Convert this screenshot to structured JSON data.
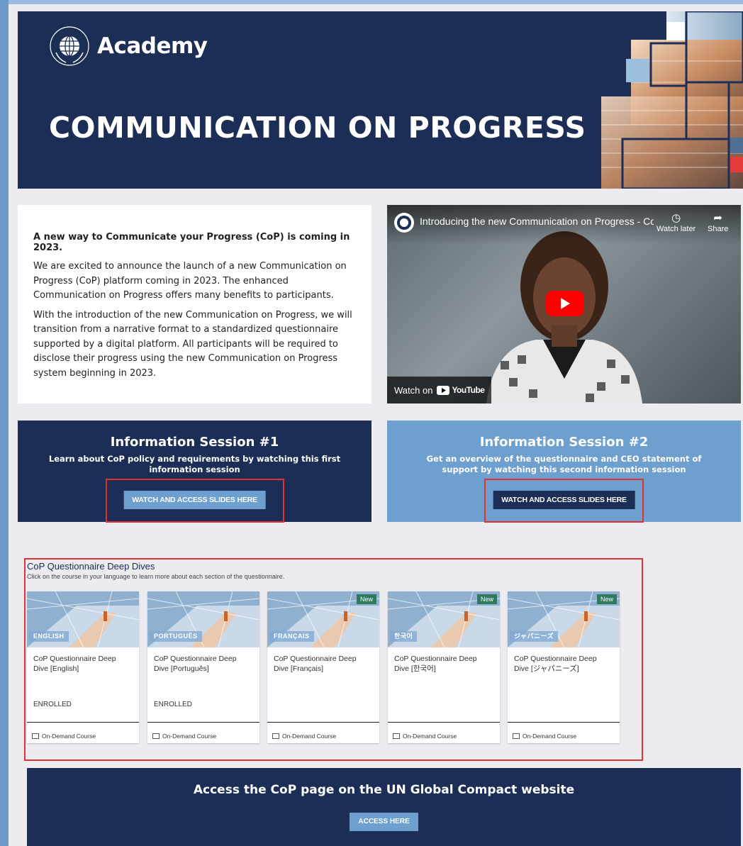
{
  "banner": {
    "brand": "Academy",
    "title": "COMMUNICATION ON PROGRESS"
  },
  "intro": {
    "heading": "A new way to Communicate your Progress (CoP) is coming in 2023.",
    "paragraph1": "We are excited to announce the launch of a new Communication on Progress (CoP) platform coming in 2023. The enhanced Communication on Progress offers many benefits to participants.",
    "paragraph2": "With the introduction of the new Communication on Progress, we will transition from a narrative format to a standardized questionnaire supported by a digital platform. All participants will be required to disclose their progress using the new Communication on Progress system beginning in 2023."
  },
  "video": {
    "title": "Introducing the new Communication on Progress - Co...",
    "watch_later": "Watch later",
    "share": "Share",
    "watch_on": "Watch on",
    "youtube": "YouTube"
  },
  "sessions": [
    {
      "title": "Information Session #1",
      "description": "Learn about CoP policy and requirements by watching this first information session",
      "button": "WATCH AND ACCESS SLIDES HERE"
    },
    {
      "title": "Information Session #2",
      "description": "Get an overview of the questionnaire and CEO statement of support by watching this second information session",
      "button": "WATCH AND ACCESS SLIDES HERE"
    }
  ],
  "deep_dives": {
    "title": "CoP Questionnaire Deep Dives",
    "subtitle": "Click on the course in your language to learn more about each section of the questionnaire.",
    "courses": [
      {
        "lang_tag": "ENGLISH",
        "title": "CoP Questionnaire Deep Dive [English]",
        "status": "ENROLLED",
        "new": "",
        "type": "On-Demand Course"
      },
      {
        "lang_tag": "PORTUGUÊS",
        "title": "CoP Questionnaire Deep Dive [Português]",
        "status": "ENROLLED",
        "new": "",
        "type": "On-Demand Course"
      },
      {
        "lang_tag": "FRANÇAIS",
        "title": "CoP Questionnaire Deep Dive [Français]",
        "status": "",
        "new": "New",
        "type": "On-Demand Course"
      },
      {
        "lang_tag": "한국어",
        "title": "CoP Questionnaire Deep Dive [한국어]",
        "status": "",
        "new": "New",
        "type": "On-Demand Course"
      },
      {
        "lang_tag": "ジャパニーズ",
        "title": "CoP Questionnaire Deep Dive [ジャパニーズ]",
        "status": "",
        "new": "New",
        "type": "On-Demand Course"
      }
    ]
  },
  "access": {
    "title": "Access the CoP page on the UN Global Compact website",
    "button": "ACCESS HERE"
  }
}
